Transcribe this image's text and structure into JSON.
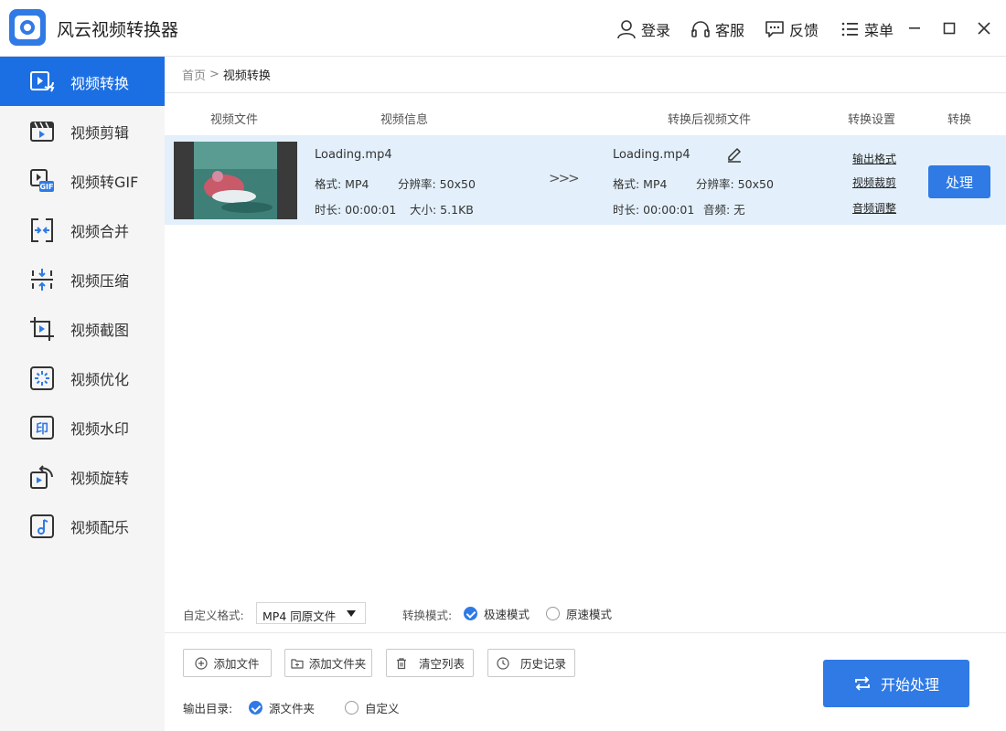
{
  "app": {
    "title": "风云视频转换器"
  },
  "topbar": {
    "login": "登录",
    "service": "客服",
    "feedback": "反馈",
    "menu": "菜单"
  },
  "sidebar": {
    "items": [
      {
        "label": "视频转换",
        "icon": "video-convert-icon",
        "active": true
      },
      {
        "label": "视频剪辑",
        "icon": "clapperboard-icon"
      },
      {
        "label": "视频转GIF",
        "icon": "gif-icon"
      },
      {
        "label": "视频合并",
        "icon": "merge-icon"
      },
      {
        "label": "视频压缩",
        "icon": "compress-icon"
      },
      {
        "label": "视频截图",
        "icon": "crop-icon"
      },
      {
        "label": "视频优化",
        "icon": "optimize-icon"
      },
      {
        "label": "视频水印",
        "icon": "watermark-icon"
      },
      {
        "label": "视频旋转",
        "icon": "rotate-icon"
      },
      {
        "label": "视频配乐",
        "icon": "music-icon"
      }
    ]
  },
  "breadcrumb": {
    "home": "首页",
    "separator": ">",
    "current": "视频转换"
  },
  "columns": {
    "file": "视频文件",
    "info": "视频信息",
    "output": "转换后视频文件",
    "settings": "转换设置",
    "convert": "转换"
  },
  "file": {
    "name": "Loading.mp4",
    "format": "格式: MP4",
    "resolution": "分辨率: 50x50",
    "duration": "时长: 00:00:01",
    "size": "大小: 5.1KB",
    "arrow": ">>>",
    "out_name": "Loading.mp4",
    "out_format": "格式: MP4",
    "out_resolution": "分辨率: 50x50",
    "out_duration": "时长: 00:00:01",
    "out_audio": "音频: 无",
    "links": {
      "format": "输出格式",
      "crop": "视频裁剪",
      "audio": "音频调整"
    },
    "process_button": "处理"
  },
  "options": {
    "format_label": "自定义格式:",
    "format_value": "MP4 同原文件",
    "mode_label": "转换模式:",
    "mode_fast": "极速模式",
    "mode_original": "原速模式"
  },
  "toolbar": {
    "add_file": "添加文件",
    "add_folder": "添加文件夹",
    "clear_list": "清空列表",
    "history": "历史记录"
  },
  "output": {
    "label": "输出目录:",
    "source": "源文件夹",
    "custom": "自定义"
  },
  "start_button": "开始处理",
  "colors": {
    "accent": "#2f7ae5",
    "sidebar_active": "#1c6fe3",
    "row_bg": "#e3f0fb"
  }
}
